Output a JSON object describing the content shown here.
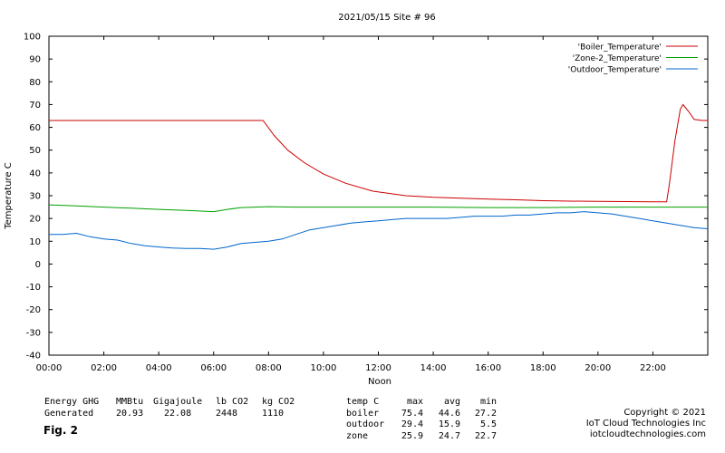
{
  "chart_data": {
    "type": "line",
    "title": "2021/05/15  Site # 96",
    "ylabel": "Temperature C",
    "xlabel": "Noon",
    "ylim": [
      -40,
      100
    ],
    "y_ticks": [
      "100",
      "90",
      "80",
      "70",
      "60",
      "50",
      "40",
      "30",
      "20",
      "10",
      "0",
      "-10",
      "-20",
      "-30",
      "-40"
    ],
    "xlim": [
      0,
      24
    ],
    "x_ticks": [
      "00:00",
      "02:00",
      "04:00",
      "06:00",
      "08:00",
      "10:00",
      "12:00",
      "14:00",
      "16:00",
      "18:00",
      "20:00",
      "22:00"
    ],
    "grid": false,
    "legend_position": "top-right",
    "series": [
      {
        "name": "'Boiler_Temperature'",
        "color": "#cc0000",
        "x": [
          0,
          1,
          2,
          3,
          4,
          5,
          6,
          7,
          7.8,
          8.2,
          8.7,
          9.3,
          10,
          10.8,
          11.8,
          13,
          14,
          15,
          16,
          17,
          18,
          19,
          20,
          21,
          22,
          22.5,
          22.6,
          22.8,
          23.0,
          23.1,
          23.3,
          23.5,
          23.8,
          24
        ],
        "y": [
          63,
          63,
          63,
          63,
          63,
          63,
          63,
          63,
          63,
          56.5,
          50,
          44.5,
          39.5,
          35.5,
          32,
          30,
          29.3,
          28.9,
          28.5,
          28.2,
          27.8,
          27.6,
          27.5,
          27.4,
          27.3,
          27.3,
          35,
          54,
          68,
          70,
          67,
          63.5,
          63,
          63
        ]
      },
      {
        "name": "'Zone-2_Temperature'",
        "color": "#00a000",
        "x": [
          0,
          1,
          2,
          3,
          4,
          5,
          6,
          6.5,
          7,
          8,
          9,
          10,
          12,
          14,
          16,
          18,
          20,
          22,
          23,
          24
        ],
        "y": [
          26,
          25.5,
          25,
          24.5,
          24,
          23.5,
          23,
          24,
          24.8,
          25.2,
          25,
          25,
          25,
          25,
          24.8,
          24.8,
          25,
          25,
          25,
          25
        ]
      },
      {
        "name": "'Outdoor_Temperature'",
        "color": "#0066cc",
        "x": [
          0,
          0.5,
          1,
          1.5,
          2,
          2.5,
          3,
          3.5,
          4,
          4.5,
          5,
          5.5,
          6,
          6.5,
          7,
          7.5,
          8,
          8.5,
          9,
          9.5,
          10,
          10.5,
          11,
          11.5,
          12,
          12.5,
          13,
          13.5,
          14,
          14.5,
          15,
          15.5,
          16,
          16.5,
          17,
          17.5,
          18,
          18.5,
          19,
          19.5,
          20,
          20.5,
          21,
          21.5,
          22,
          22.5,
          23,
          23.5,
          24
        ],
        "y": [
          13,
          13,
          13.5,
          12,
          11,
          10.5,
          9,
          8,
          7.5,
          7,
          6.8,
          6.8,
          6.5,
          7.5,
          9,
          9.5,
          10,
          11,
          13,
          15,
          16,
          17,
          18,
          18.5,
          19,
          19.5,
          20,
          20,
          20,
          20,
          20.5,
          21,
          21,
          21,
          21.5,
          21.5,
          22,
          22.5,
          22.5,
          23,
          22.5,
          22,
          21,
          20,
          19,
          18,
          17,
          16,
          15.5
        ]
      }
    ]
  },
  "stats_left": {
    "header": [
      "Energy GHG",
      "MMBtu",
      "Gigajoule",
      "lb CO2",
      "kg CO2"
    ],
    "row": [
      "Generated",
      "20.93",
      "22.08",
      "2448",
      "1110"
    ]
  },
  "stats_right": {
    "header": [
      "temp C",
      "max",
      "avg",
      "min"
    ],
    "rows": [
      [
        "boiler",
        "75.4",
        "44.6",
        "27.2"
      ],
      [
        "outdoor",
        "29.4",
        "15.9",
        "5.5"
      ],
      [
        "zone",
        "25.9",
        "24.7",
        "22.7"
      ]
    ]
  },
  "fig_label": "Fig. 2",
  "copyright": [
    "Copyright © 2021",
    "IoT Cloud Technologies Inc",
    "iotcloudtechnologies.com"
  ]
}
